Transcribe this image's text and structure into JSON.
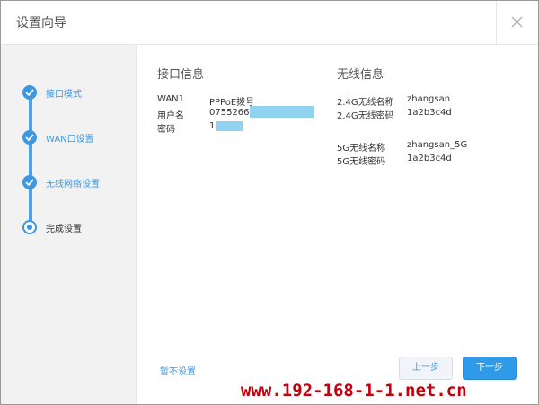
{
  "dialog": {
    "title": "设置向导"
  },
  "steps": [
    {
      "label": "接口模式",
      "state": "done"
    },
    {
      "label": "WAN口设置",
      "state": "done"
    },
    {
      "label": "无线网络设置",
      "state": "done"
    },
    {
      "label": "完成设置",
      "state": "current"
    }
  ],
  "interface": {
    "title": "接口信息",
    "rows": [
      {
        "key": "WAN1",
        "value": "PPPoE拨号"
      },
      {
        "key": "用户名",
        "value": "0755266"
      },
      {
        "key": "密码",
        "value": "1"
      }
    ]
  },
  "wireless": {
    "title": "无线信息",
    "rows": [
      {
        "key": "2.4G无线名称",
        "value": "zhangsan"
      },
      {
        "key": "2.4G无线密码",
        "value": "1a2b3c4d"
      },
      {
        "key": "5G无线名称",
        "value": "zhangsan_5G"
      },
      {
        "key": "5G无线密码",
        "value": "1a2b3c4d"
      }
    ]
  },
  "actions": {
    "skip": "暂不设置",
    "prev": "上一步",
    "next": "下一步"
  },
  "watermark": "www.192-168-1-1.net.cn",
  "colors": {
    "accent": "#3d98e4",
    "primary_button": "#2f9be8",
    "mask": "#8fd3ee",
    "watermark": "#c4000d"
  }
}
